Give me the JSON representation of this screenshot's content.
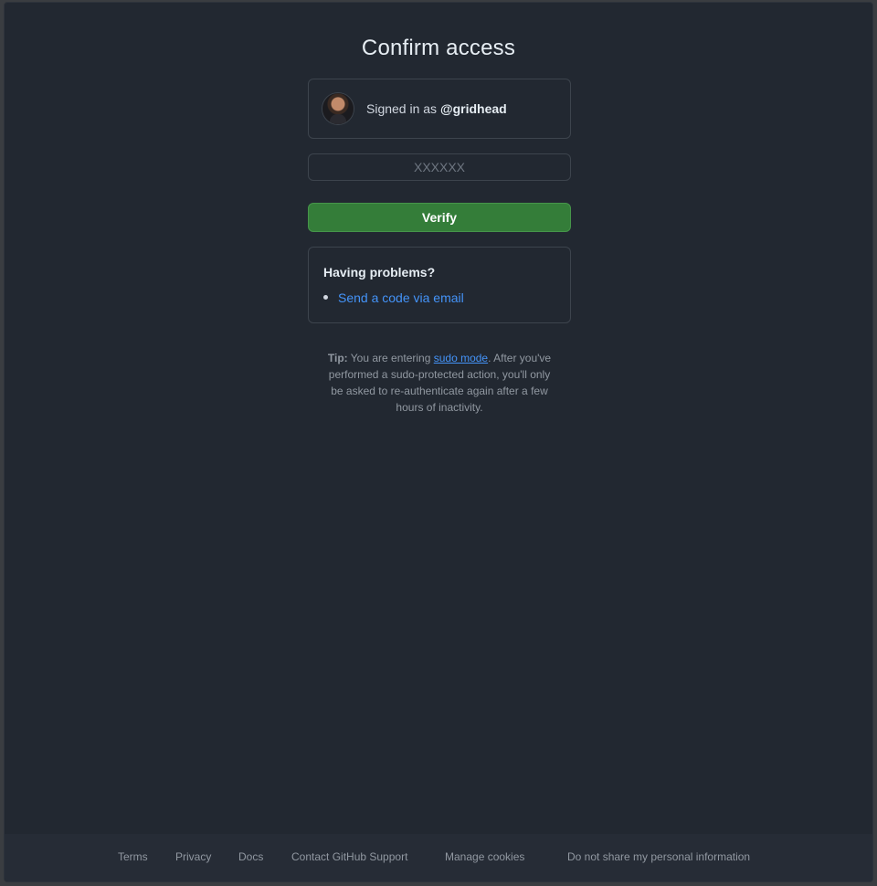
{
  "page": {
    "title": "Confirm access"
  },
  "account": {
    "signed_in_prefix": "Signed in as ",
    "username": "@gridhead"
  },
  "verification": {
    "code_placeholder": "XXXXXX",
    "code_value": "",
    "verify_label": "Verify"
  },
  "help": {
    "heading": "Having problems?",
    "options": [
      {
        "label": "Send a code via email"
      }
    ]
  },
  "tip": {
    "label": "Tip:",
    "before_link": " You are entering ",
    "link": "sudo mode",
    "after_link": ". After you've performed a sudo-protected action, you'll only be asked to re-authenticate again after a few hours of inactivity."
  },
  "footer": {
    "links": [
      "Terms",
      "Privacy",
      "Docs",
      "Contact GitHub Support",
      "Manage cookies",
      "Do not share my personal information"
    ]
  },
  "colors": {
    "background": "#222831",
    "accent_link": "#4493f8",
    "button_green": "#347d39",
    "border": "#3d444d"
  },
  "icons": {
    "avatar": "user-avatar"
  }
}
